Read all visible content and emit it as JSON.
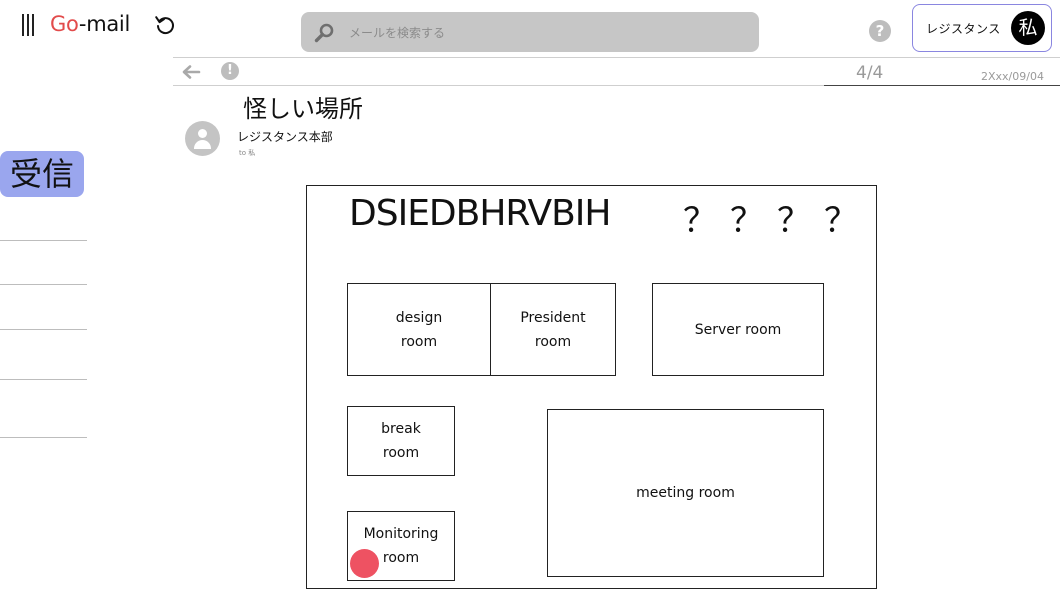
{
  "app": {
    "logo_part1": "Go",
    "logo_part2": "-mail"
  },
  "search": {
    "placeholder": "メールを検索する",
    "value": ""
  },
  "account": {
    "name": "レジスタンス",
    "avatar_text": "私"
  },
  "toolbar": {
    "pager": "4/4",
    "date": "2Xxx/09/04"
  },
  "sidebar": {
    "inbox_label": "受信"
  },
  "message": {
    "subject": "怪しい場所",
    "sender": "レジスタンス本部",
    "recipient": "to 私"
  },
  "floor_plan": {
    "code": "DSIEDBHRVBIH",
    "unknown_marks": "？？？？",
    "rooms": {
      "design": "design\nroom",
      "president": "President\nroom",
      "server": "Server room",
      "break": "break\nroom",
      "meeting": "meeting room",
      "monitoring": "Monitoring\nroom"
    },
    "marker_room": "monitoring",
    "marker_color": "#ee5262"
  },
  "colors": {
    "logo_accent": "#e24b4b",
    "inbox_highlight": "#9aa6ee",
    "account_border": "#8a86e0",
    "search_bg": "#c6c6c6"
  },
  "icons": [
    "menu-icon",
    "refresh-icon",
    "search-icon",
    "help-icon",
    "back-arrow-icon",
    "report-icon",
    "sender-avatar-icon"
  ]
}
